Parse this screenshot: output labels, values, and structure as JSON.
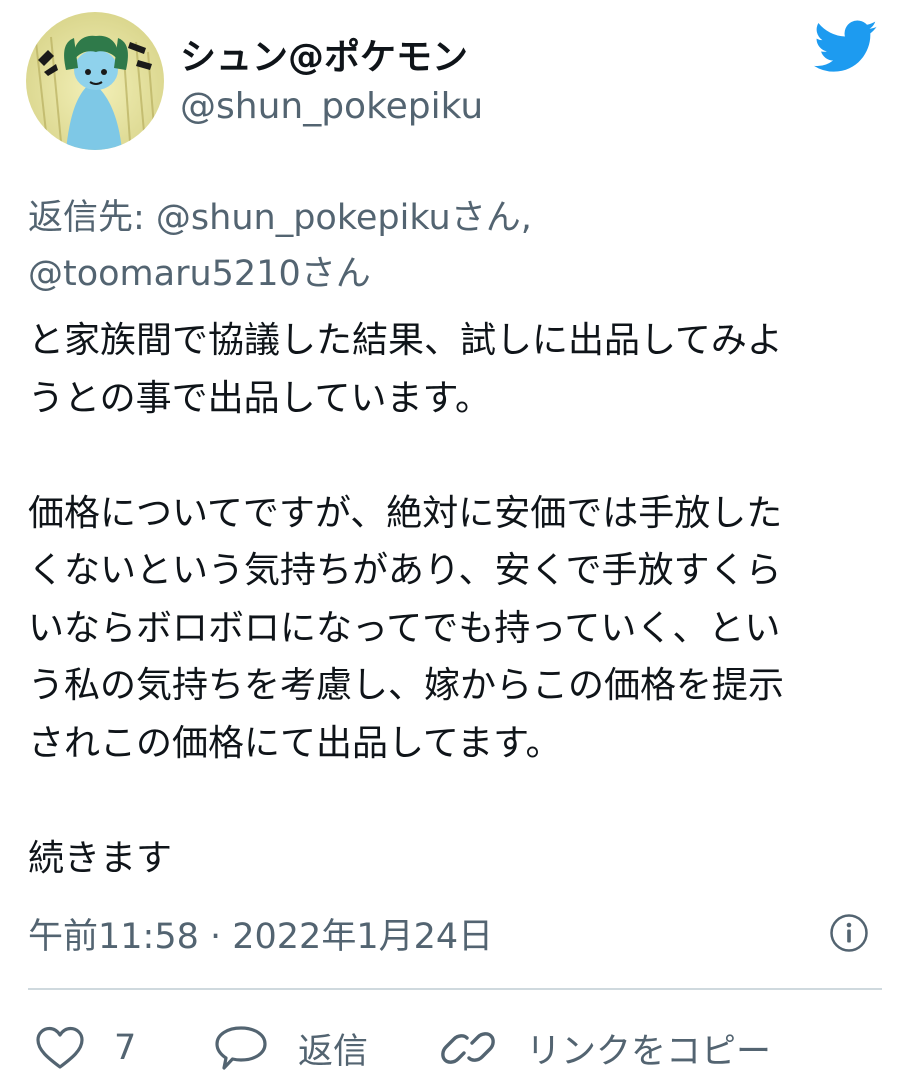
{
  "tweet": {
    "author": {
      "display_name": "シュン@ポケモン",
      "handle": "@shun_pokepiku",
      "avatar_icon": "avatar-image"
    },
    "platform_icon": "twitter-bird-icon",
    "reply_to": {
      "prefix": "返信先: ",
      "mention_1": "@shun_pokepikuさん,",
      "mention_2": "@toomaru5210さん"
    },
    "body_lines": [
      "と家族間で協議した結果、試しに出品してみよ",
      "うとの事で出品しています。",
      "",
      "価格についてですが、絶対に安価では手放した",
      "くないという気持ちがあり、安くで手放すくら",
      "いならボロボロになってでも持っていく、とい",
      "う私の気持ちを考慮し、嫁からこの価格を提示",
      "されこの価格にて出品してます。",
      "",
      "続きます"
    ],
    "timestamp": "午前11:58 · 2022年1月24日",
    "actions": {
      "like_count": "7",
      "reply_label": "返信",
      "copy_link_label": "リンクをコピー"
    }
  },
  "colors": {
    "text": "#0f1419",
    "secondary": "#536471",
    "twitter_blue": "#1d9bf0",
    "divider": "#cfd9de"
  }
}
